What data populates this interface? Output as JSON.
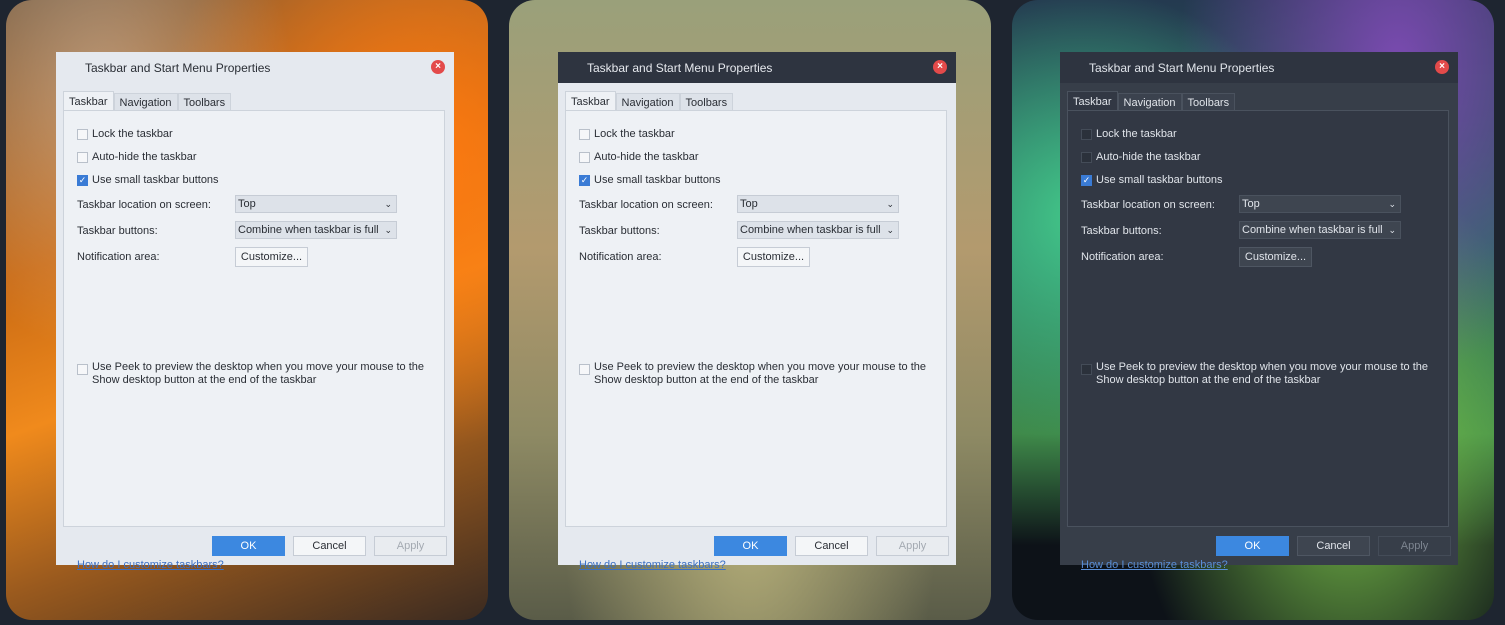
{
  "dialog": {
    "title": "Taskbar and Start Menu Properties",
    "close_glyph": "×",
    "tabs": [
      "Taskbar",
      "Navigation",
      "Toolbars"
    ],
    "options": {
      "lock": "Lock the taskbar",
      "autohide": "Auto-hide the taskbar",
      "small_buttons": "Use small taskbar buttons"
    },
    "checkmark": "✓",
    "location_label": "Taskbar location on screen:",
    "location_value": "Top",
    "buttons_label": "Taskbar buttons:",
    "buttons_value": "Combine when taskbar is full",
    "dropdown_arrow": "⌄",
    "notification_label": "Notification area:",
    "customize_label": "Customize...",
    "peek_text": "Use Peek to preview the desktop when you move your mouse to the Show desktop button at the end of the taskbar",
    "help_link": "How do I customize taskbars?",
    "ok": "OK",
    "cancel": "Cancel",
    "apply": "Apply"
  },
  "themes": [
    "light",
    "mixed",
    "dark"
  ],
  "colors": {
    "accent": "#3c88e0",
    "close": "#e34a4a",
    "link": "#3a6fc4"
  }
}
